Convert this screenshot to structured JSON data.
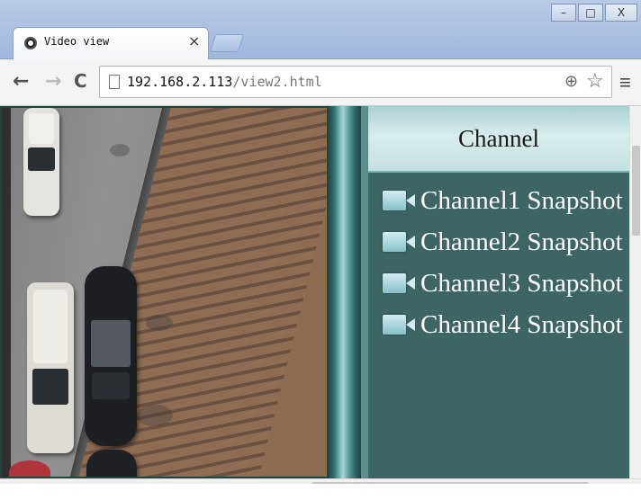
{
  "browser": {
    "tab_title": "Video view",
    "tab_close": "×",
    "url_host": "192.168.2.113",
    "url_path": "/view2.html",
    "window_controls": {
      "minimize": "–",
      "maximize": "□",
      "close": "X"
    },
    "nav": {
      "back": "←",
      "forward": "→",
      "reload": "C"
    },
    "icons": {
      "zoom": "⊕",
      "bookmark": "☆",
      "menu": "≡"
    }
  },
  "page": {
    "panel": {
      "title": "Channel",
      "channels": [
        {
          "label": "Channel1 Snapshot",
          "icon": "camera-icon"
        },
        {
          "label": "Channel2 Snapshot",
          "icon": "camera-icon"
        },
        {
          "label": "Channel3 Snapshot",
          "icon": "camera-icon"
        },
        {
          "label": "Channel4 Snapshot",
          "icon": "camera-icon"
        }
      ]
    },
    "colors": {
      "panel_bg": "#3d6563",
      "header_bg": "#d8ecec",
      "channel_text": "#ffffff"
    }
  }
}
